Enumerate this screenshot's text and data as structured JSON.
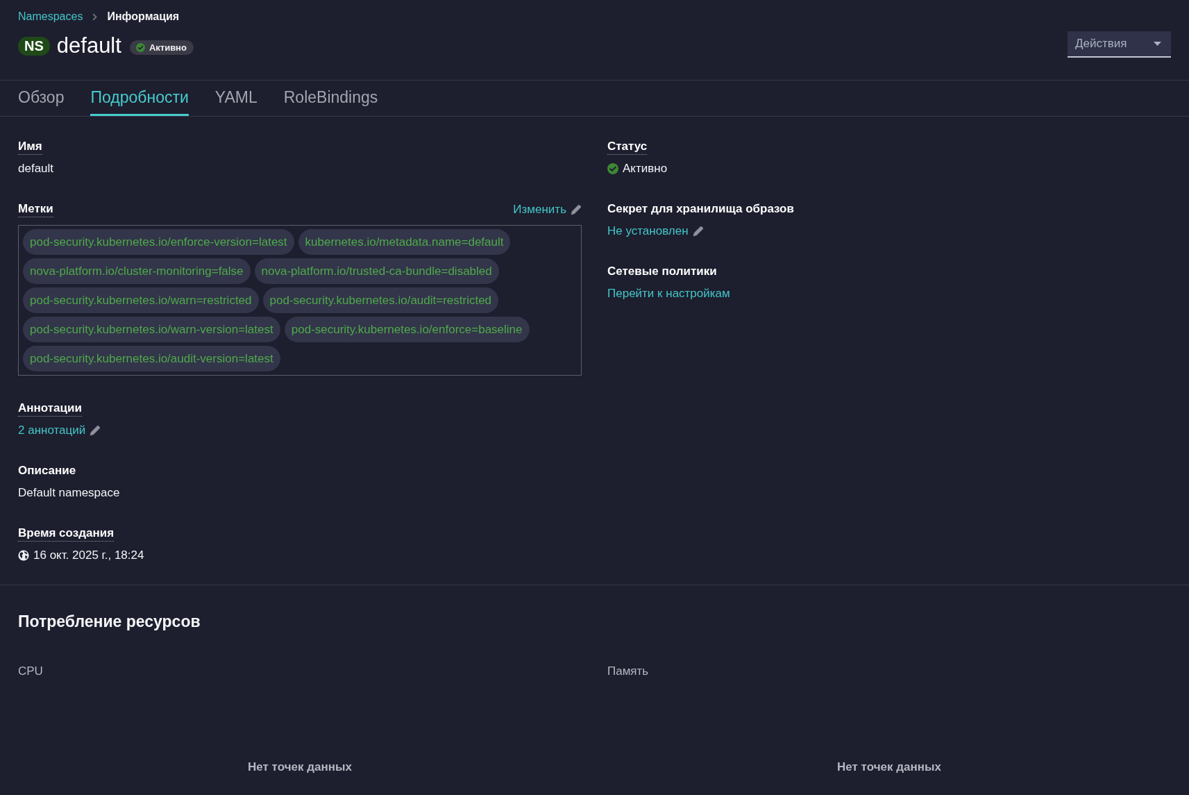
{
  "breadcrumb": [
    {
      "label": "Namespaces",
      "current": false
    },
    {
      "label": "Информация",
      "current": true
    }
  ],
  "header": {
    "type_badge": "NS",
    "title": "default",
    "status": {
      "label": "Активно"
    },
    "actions_button": {
      "label": "Действия"
    }
  },
  "tabs": [
    {
      "label": "Обзор",
      "selected": false
    },
    {
      "label": "Подробности",
      "selected": true
    },
    {
      "label": "YAML",
      "selected": false
    },
    {
      "label": "RoleBindings",
      "selected": false
    }
  ],
  "details": {
    "left": [
      {
        "kind": "text",
        "label": "Имя",
        "help": true,
        "value": "default"
      },
      {
        "kind": "labels",
        "label": "Метки",
        "help": true,
        "edit_link": "Изменить",
        "labels": [
          "pod-security.kubernetes.io/enforce-version=latest",
          "kubernetes.io/metadata.name=default",
          "nova-platform.io/cluster-monitoring=false",
          "nova-platform.io/trusted-ca-bundle=disabled",
          "pod-security.kubernetes.io/warn=restricted",
          "pod-security.kubernetes.io/audit=restricted",
          "pod-security.kubernetes.io/warn-version=latest",
          "pod-security.kubernetes.io/enforce=baseline",
          "pod-security.kubernetes.io/audit-version=latest"
        ]
      },
      {
        "kind": "link",
        "label": "Аннотации",
        "help": true,
        "value": "2 аннотаций",
        "editable": true
      },
      {
        "kind": "text",
        "label": "Описание",
        "help": false,
        "value": "Default namespace"
      },
      {
        "kind": "timestamp",
        "label": "Время создания",
        "help": true,
        "value": "16 окт. 2025 г., 18:24"
      }
    ],
    "right": [
      {
        "kind": "status",
        "label": "Статус",
        "help": true,
        "value": "Активно"
      },
      {
        "kind": "link",
        "label": "Секрет для хранилища образов",
        "help": false,
        "value": "Не установлен",
        "editable": true
      },
      {
        "kind": "link",
        "label": "Сетевые политики",
        "help": false,
        "value": "Перейти к настройкам",
        "editable": false
      }
    ]
  },
  "resource_usage": {
    "title": "Потребление ресурсов",
    "charts": [
      {
        "title": "CPU",
        "empty_message": "Нет точек данных"
      },
      {
        "title": "Память",
        "empty_message": "Нет точек данных"
      }
    ]
  }
}
